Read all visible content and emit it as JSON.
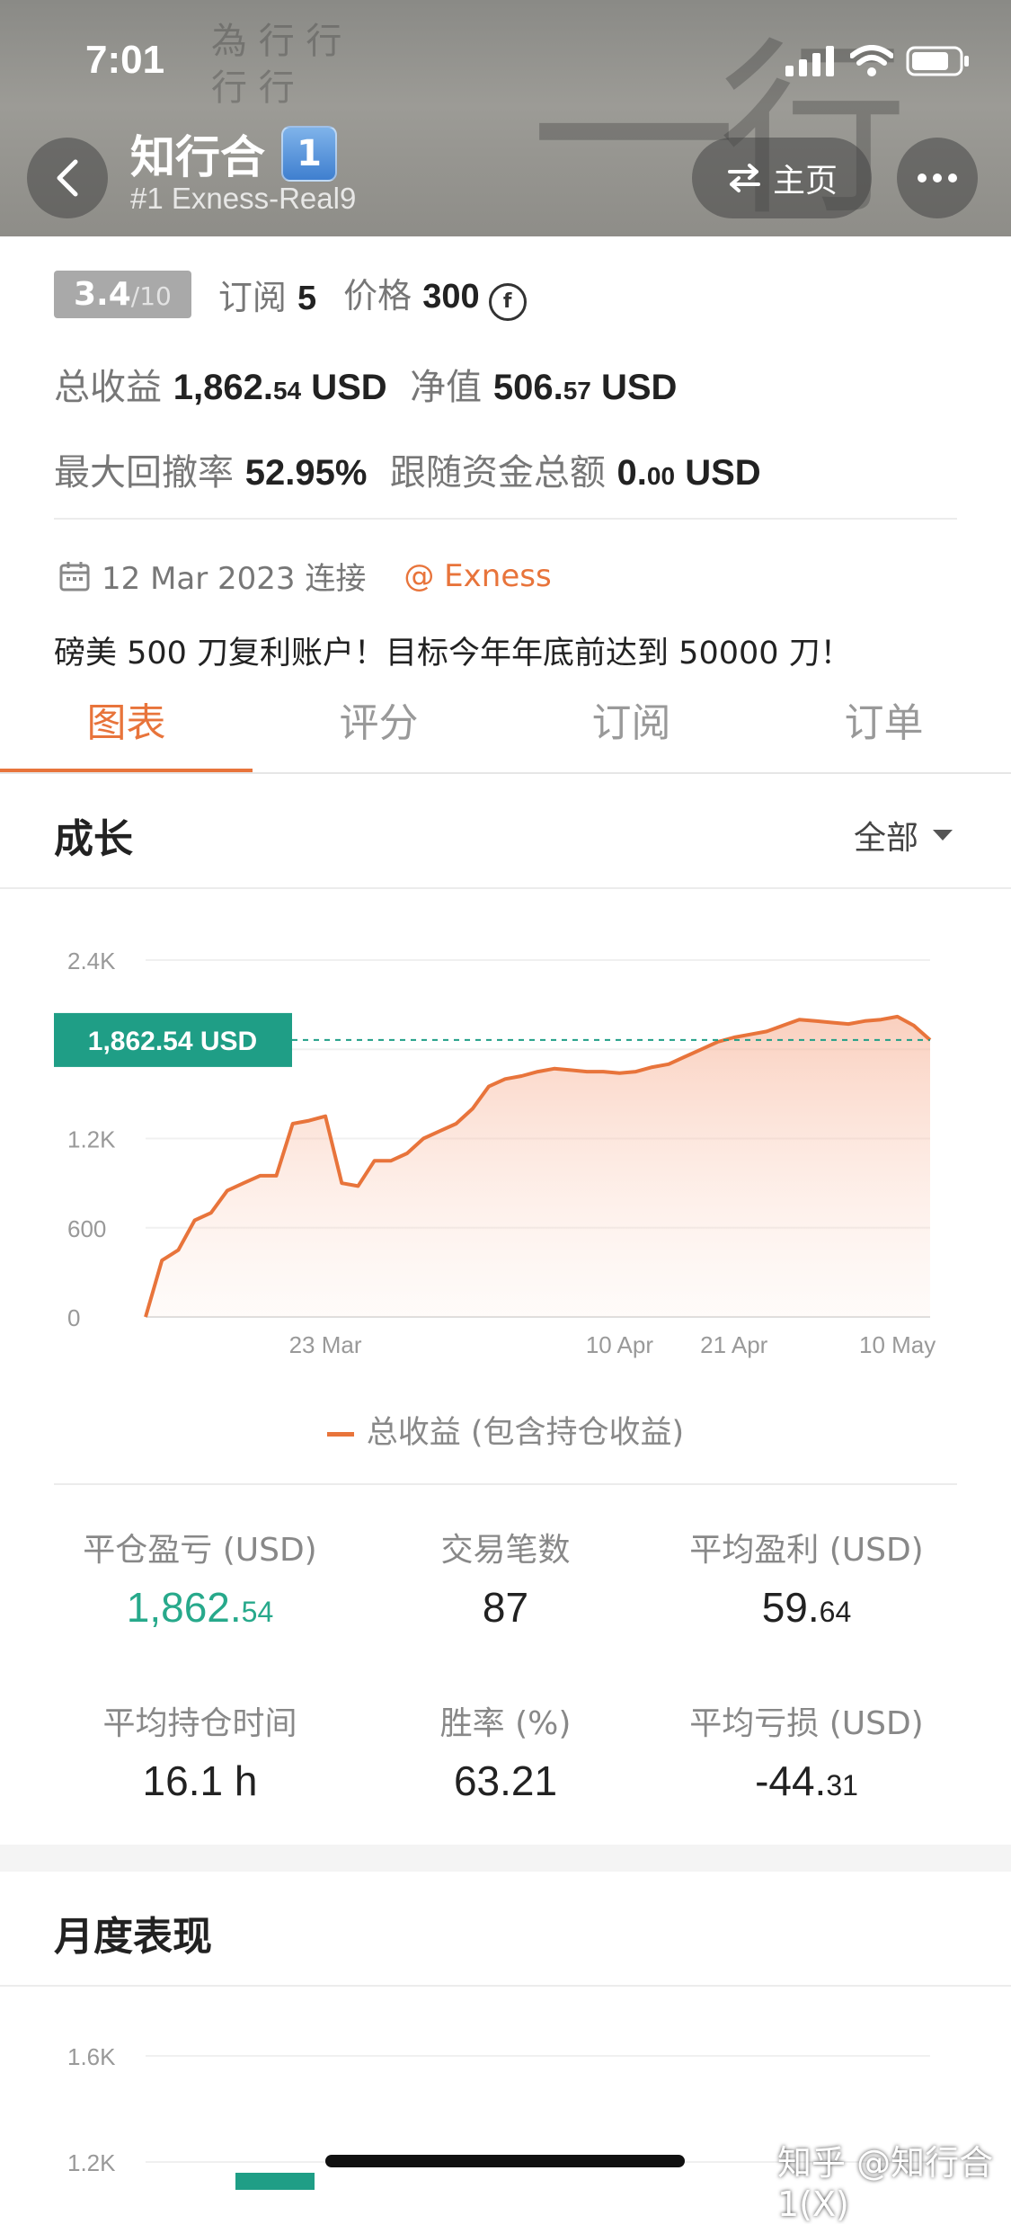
{
  "status_bar": {
    "time": "7:01"
  },
  "header": {
    "title": "知行合",
    "rank": "1",
    "subtitle": "#1 Exness-Real9",
    "home_label": "主页",
    "brush_text_1": "一",
    "brush_text_2": "行",
    "brush_small": "為 行 行 行 行"
  },
  "info": {
    "score_main": "3.4",
    "score_sub": "/10",
    "subscribe_label": "订阅",
    "subscribe_count": "5",
    "price_label": "价格",
    "price_value": "300",
    "total_profit_label": "总收益",
    "total_profit_int": "1,862.",
    "total_profit_dec": "54",
    "total_profit_unit": "USD",
    "net_label": "净值",
    "net_int": "506.",
    "net_dec": "57",
    "net_unit": "USD",
    "drawdown_label": "最大回撤率",
    "drawdown_value": "52.95%",
    "follow_label": "跟随资金总额",
    "follow_int": "0.",
    "follow_dec": "00",
    "follow_unit": "USD",
    "connect_date": "12 Mar 2023 连接",
    "broker": "@ Exness",
    "description": "磅美 500 刀复利账户！目标今年年底前达到 50000 刀！"
  },
  "tabs": [
    "图表",
    "评分",
    "订阅",
    "订单"
  ],
  "growth": {
    "title": "成长",
    "filter": "全部",
    "legend": "总收益 (包含持仓收益)",
    "current_label": "1,862.54 USD"
  },
  "chart_data": [
    {
      "type": "area",
      "title": "成长",
      "series": [
        {
          "name": "总收益 (包含持仓收益)",
          "color": "#e8743b"
        }
      ],
      "x": [
        "12 Mar",
        "13 Mar",
        "14 Mar",
        "15 Mar",
        "16 Mar",
        "17 Mar",
        "18 Mar",
        "19 Mar",
        "20 Mar",
        "21 Mar",
        "22 Mar",
        "23 Mar",
        "24 Mar",
        "25 Mar",
        "26 Mar",
        "27 Mar",
        "28 Mar",
        "29 Mar",
        "30 Mar",
        "31 Mar",
        "1 Apr",
        "2 Apr",
        "3 Apr",
        "4 Apr",
        "5 Apr",
        "6 Apr",
        "7 Apr",
        "8 Apr",
        "9 Apr",
        "10 Apr",
        "12 Apr",
        "14 Apr",
        "16 Apr",
        "18 Apr",
        "19 Apr",
        "20 Apr",
        "21 Apr",
        "23 Apr",
        "25 Apr",
        "27 Apr",
        "29 Apr",
        "1 May",
        "3 May",
        "5 May",
        "7 May",
        "9 May",
        "10 May",
        "11 May",
        "12 May"
      ],
      "y": [
        0,
        380,
        450,
        650,
        700,
        850,
        900,
        950,
        950,
        1300,
        1320,
        1350,
        900,
        880,
        1050,
        1050,
        1100,
        1200,
        1250,
        1300,
        1400,
        1550,
        1600,
        1620,
        1650,
        1670,
        1660,
        1650,
        1650,
        1640,
        1650,
        1680,
        1700,
        1750,
        1800,
        1850,
        1880,
        1900,
        1920,
        1960,
        2000,
        1990,
        1980,
        1970,
        1990,
        2000,
        2020,
        1960,
        1862.54
      ],
      "xticks": [
        "23 Mar",
        "10 Apr",
        "21 Apr",
        "10 May"
      ],
      "yticks": [
        "0",
        "600",
        "1.2K",
        "2.4K"
      ],
      "ylim": [
        0,
        2400
      ],
      "current_value": 1862.54,
      "current_label": "1,862.54 USD",
      "grid": true
    },
    {
      "type": "bar",
      "title": "月度表现",
      "yticks": [
        "1.2K",
        "1.6K"
      ],
      "ylim": [
        1200,
        1600
      ],
      "values": [
        1200
      ],
      "color": "#1f9e86"
    }
  ],
  "stats": [
    {
      "label": "平仓盈亏 (USD)",
      "int": "1,862.",
      "dec": "54",
      "green": true
    },
    {
      "label": "交易笔数",
      "int": "87",
      "dec": "",
      "green": false
    },
    {
      "label": "平均盈利 (USD)",
      "int": "59.",
      "dec": "64",
      "green": false
    },
    {
      "label": "平均持仓时间",
      "int": "16.1 h",
      "dec": "",
      "green": false
    },
    {
      "label": "胜率 (%)",
      "int": "63.21",
      "dec": "",
      "green": false
    },
    {
      "label": "平均亏损 (USD)",
      "int": "-44.",
      "dec": "31",
      "green": false
    }
  ],
  "monthly": {
    "title": "月度表现"
  },
  "watermark": "知乎 @知行合1(X)"
}
